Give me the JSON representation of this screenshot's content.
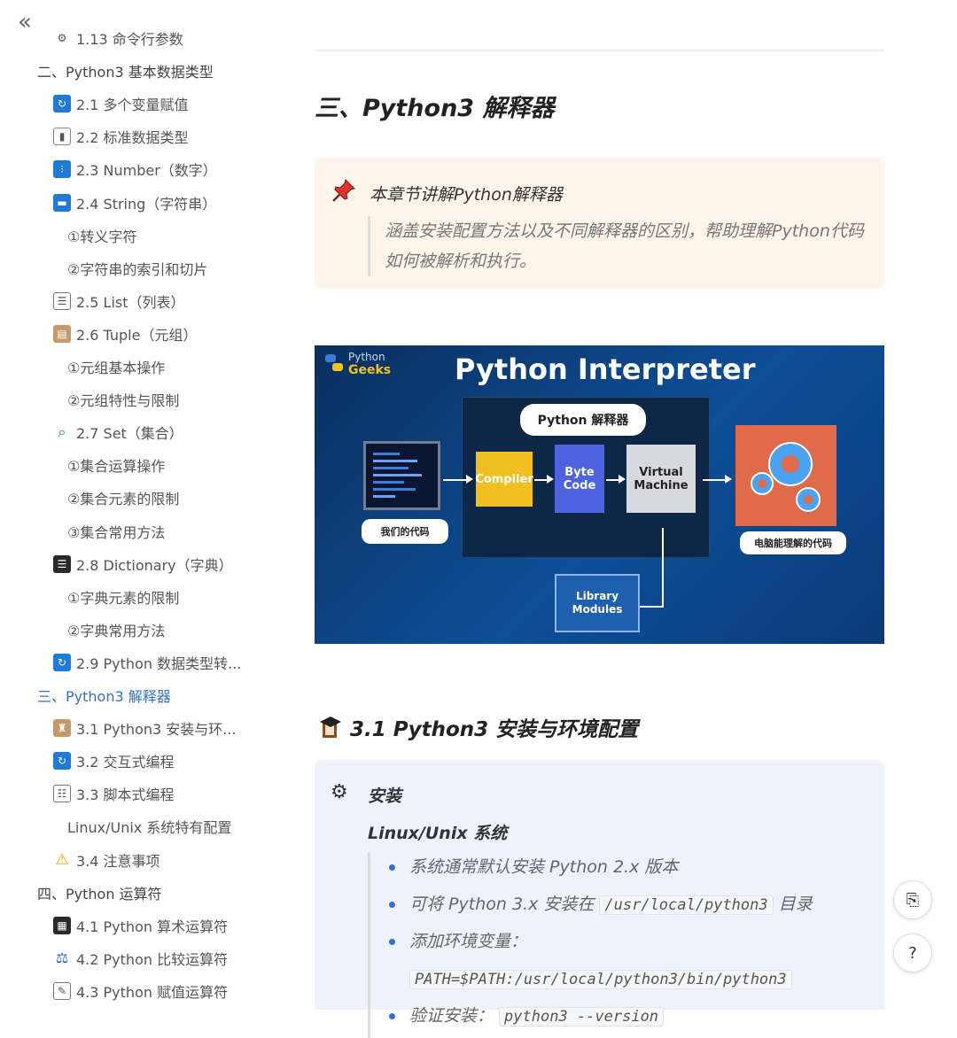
{
  "sidebar": {
    "collapse_glyph": "«",
    "items": [
      {
        "label": "1.13 命令行参数",
        "level": 2,
        "icon": "gear-icon"
      },
      {
        "label": "二、Python3 基本数据类型",
        "level": 1,
        "icon": ""
      },
      {
        "label": "2.1 多个变量赋值",
        "level": 2,
        "icon": "refresh-icon"
      },
      {
        "label": "2.2 标准数据类型",
        "level": 2,
        "icon": "bar-chart-icon"
      },
      {
        "label": "2.3 Number（数字）",
        "level": 2,
        "icon": "grid-icon"
      },
      {
        "label": "2.4 String（字符串）",
        "level": 2,
        "icon": "minus-box-icon"
      },
      {
        "label": "①转义字符",
        "level": 3,
        "icon": ""
      },
      {
        "label": "②字符串的索引和切片",
        "level": 3,
        "icon": ""
      },
      {
        "label": "2.5 List（列表）",
        "level": 2,
        "icon": "clipboard-icon"
      },
      {
        "label": "2.6 Tuple（元组）",
        "level": 2,
        "icon": "book-icon"
      },
      {
        "label": "①元组基本操作",
        "level": 3,
        "icon": ""
      },
      {
        "label": "②元组特性与限制",
        "level": 3,
        "icon": ""
      },
      {
        "label": "2.7 Set（集合）",
        "level": 2,
        "icon": "magnifier-icon"
      },
      {
        "label": "①集合运算操作",
        "level": 3,
        "icon": ""
      },
      {
        "label": "②集合元素的限制",
        "level": 3,
        "icon": ""
      },
      {
        "label": "③集合常用方法",
        "level": 3,
        "icon": ""
      },
      {
        "label": "2.8 Dictionary（字典）",
        "level": 2,
        "icon": "books-icon"
      },
      {
        "label": "①字典元素的限制",
        "level": 3,
        "icon": ""
      },
      {
        "label": "②字典常用方法",
        "level": 3,
        "icon": ""
      },
      {
        "label": "2.9 Python 数据类型转...",
        "level": 2,
        "icon": "refresh-icon"
      },
      {
        "label": "三、Python3 解释器",
        "level": 1,
        "icon": "",
        "active": true
      },
      {
        "label": "3.1 Python3 安装与环...",
        "level": 2,
        "icon": "graduation-cap-icon"
      },
      {
        "label": "3.2 交互式编程",
        "level": 2,
        "icon": "refresh-icon"
      },
      {
        "label": "3.3 脚本式编程",
        "level": 2,
        "icon": "scroll-icon"
      },
      {
        "label": "Linux/Unix 系统特有配置",
        "level": 3,
        "icon": ""
      },
      {
        "label": "3.4 注意事项",
        "level": 2,
        "icon": "warning-icon"
      },
      {
        "label": "四、Python 运算符",
        "level": 1,
        "icon": ""
      },
      {
        "label": "4.1 Python 算术运算符",
        "level": 2,
        "icon": "abacus-icon"
      },
      {
        "label": "4.2 Python 比较运算符",
        "level": 2,
        "icon": "scales-icon"
      },
      {
        "label": "4.3 Python 赋值运算符",
        "level": 2,
        "icon": "memo-icon"
      }
    ]
  },
  "main": {
    "section_title": "三、Python3 解释器",
    "note": {
      "title": "本章节讲解Python解释器",
      "quote": "涵盖安装配置方法以及不同解释器的区别，帮助理解Python代码如何被解析和执行。"
    },
    "figure": {
      "brand_top": "Python",
      "brand_bottom": "Geeks",
      "title": "Python Interpreter",
      "bubble": "Python 解释器",
      "compiler": "Compiler",
      "byte_code": "Byte\nCode",
      "vm": "Virtual\nMachine",
      "library": "Library\nModules",
      "our_code": "我们的代码",
      "machine_code": "电脑能理解的代码"
    },
    "subsection_title": "3.1 Python3 安装与环境配置",
    "install": {
      "title": "安装",
      "os_title": "Linux/Unix 系统",
      "bullets": [
        {
          "text": "系统通常默认安装 Python 2.x 版本"
        },
        {
          "text_before": "可将 Python 3.x 安装在 ",
          "code": "/usr/local/python3",
          "text_after": " 目录"
        },
        {
          "text": "添加环境变量："
        },
        {
          "code": "PATH=$PATH:/usr/local/python3/bin/python3"
        },
        {
          "text_before": "验证安装： ",
          "code": "python3 --version"
        }
      ]
    }
  },
  "fab": {
    "doc_glyph": "⎘",
    "help_glyph": "?"
  },
  "colors": {
    "accent": "#2f6fd6",
    "note_bg": "#fdf4ea",
    "install_bg": "#eef2fb"
  }
}
